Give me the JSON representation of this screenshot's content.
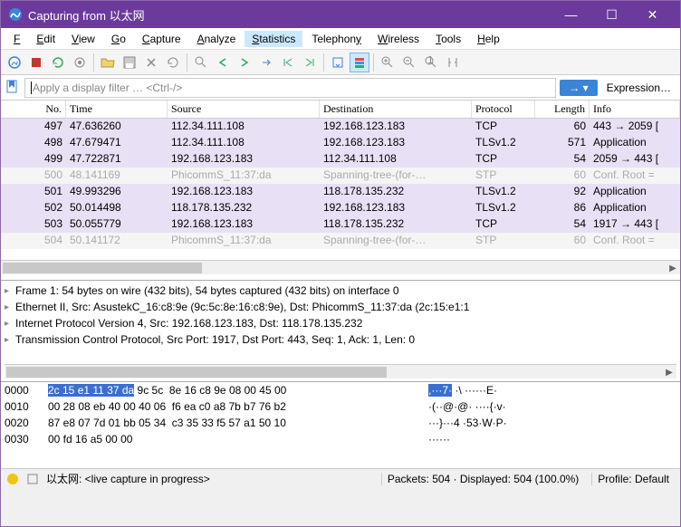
{
  "window": {
    "title": "Capturing from 以太网"
  },
  "menu": {
    "file": "File",
    "edit": "Edit",
    "view": "View",
    "go": "Go",
    "capture": "Capture",
    "analyze": "Analyze",
    "statistics": "Statistics",
    "telephony": "Telephony",
    "wireless": "Wireless",
    "tools": "Tools",
    "help": "Help"
  },
  "filter": {
    "placeholder": "Apply a display filter … <Ctrl-/>",
    "expression": "Expression…"
  },
  "columns": {
    "no": "No.",
    "time": "Time",
    "src": "Source",
    "dst": "Destination",
    "proto": "Protocol",
    "len": "Length",
    "info": "Info"
  },
  "packets": [
    {
      "no": "497",
      "time": "47.636260",
      "src": "112.34.111.108",
      "dst": "192.168.123.183",
      "proto": "TCP",
      "len": "60",
      "info": "443 → 2059 [",
      "cls": "purple"
    },
    {
      "no": "498",
      "time": "47.679471",
      "src": "112.34.111.108",
      "dst": "192.168.123.183",
      "proto": "TLSv1.2",
      "len": "571",
      "info": "Application",
      "cls": "purple"
    },
    {
      "no": "499",
      "time": "47.722871",
      "src": "192.168.123.183",
      "dst": "112.34.111.108",
      "proto": "TCP",
      "len": "54",
      "info": "2059 → 443 [",
      "cls": "purple"
    },
    {
      "no": "500",
      "time": "48.141169",
      "src": "PhicommS_11:37:da",
      "dst": "Spanning-tree-(for-…",
      "proto": "STP",
      "len": "60",
      "info": "Conf. Root =",
      "cls": "grey"
    },
    {
      "no": "501",
      "time": "49.993296",
      "src": "192.168.123.183",
      "dst": "118.178.135.232",
      "proto": "TLSv1.2",
      "len": "92",
      "info": "Application",
      "cls": "purple"
    },
    {
      "no": "502",
      "time": "50.014498",
      "src": "118.178.135.232",
      "dst": "192.168.123.183",
      "proto": "TLSv1.2",
      "len": "86",
      "info": "Application",
      "cls": "purple"
    },
    {
      "no": "503",
      "time": "50.055779",
      "src": "192.168.123.183",
      "dst": "118.178.135.232",
      "proto": "TCP",
      "len": "54",
      "info": "1917 → 443 [",
      "cls": "purple"
    },
    {
      "no": "504",
      "time": "50.141172",
      "src": "PhicommS_11:37:da",
      "dst": "Spanning-tree-(for-…",
      "proto": "STP",
      "len": "60",
      "info": "Conf. Root =",
      "cls": "grey"
    }
  ],
  "details": [
    "Frame 1: 54 bytes on wire (432 bits), 54 bytes captured (432 bits) on interface 0",
    "Ethernet II, Src: AsustekC_16:c8:9e (9c:5c:8e:16:c8:9e), Dst: PhicommS_11:37:da (2c:15:e1:1",
    "Internet Protocol Version 4, Src: 192.168.123.183, Dst: 118.178.135.232",
    "Transmission Control Protocol, Src Port: 1917, Dst Port: 443, Seq: 1, Ack: 1, Len: 0"
  ],
  "hex": [
    {
      "off": "0000",
      "sel": "2c 15 e1 11 37 da",
      "rest": " 9c 5c  8e 16 c8 9e 08 00 45 00",
      "asel": ",···7·",
      "arest": " ·\\ ······E·"
    },
    {
      "off": "0010",
      "sel": "",
      "rest": "00 28 08 eb 40 00 40 06  f6 ea c0 a8 7b b7 76 b2",
      "asel": "",
      "arest": "·(··@·@· ····{·v·"
    },
    {
      "off": "0020",
      "sel": "",
      "rest": "87 e8 07 7d 01 bb 05 34  c3 35 33 f5 57 a1 50 10",
      "asel": "",
      "arest": "···}···4 ·53·W·P·"
    },
    {
      "off": "0030",
      "sel": "",
      "rest": "00 fd 16 a5 00 00",
      "asel": "",
      "arest": "······"
    }
  ],
  "status": {
    "iface": "以太网: <live capture in progress>",
    "pkts": "Packets: 504 · Displayed: 504 (100.0%)",
    "profile": "Profile: Default"
  }
}
